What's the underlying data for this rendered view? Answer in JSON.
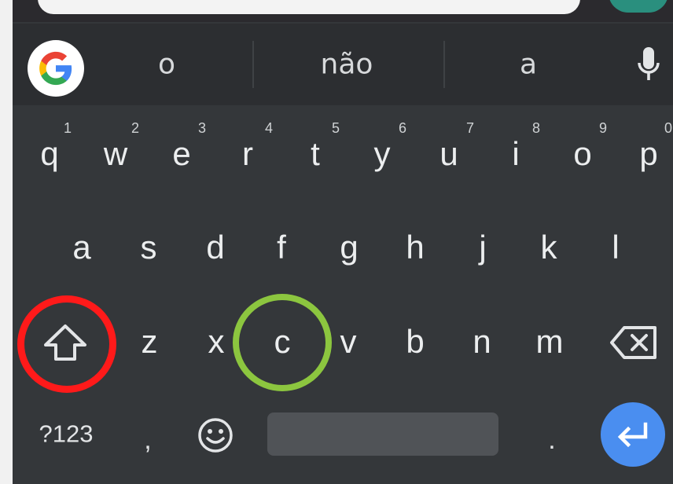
{
  "suggestions": [
    "o",
    "não",
    "a"
  ],
  "row1": [
    {
      "label": "q",
      "hint": "1"
    },
    {
      "label": "w",
      "hint": "2"
    },
    {
      "label": "e",
      "hint": "3"
    },
    {
      "label": "r",
      "hint": "4"
    },
    {
      "label": "t",
      "hint": "5"
    },
    {
      "label": "y",
      "hint": "6"
    },
    {
      "label": "u",
      "hint": "7"
    },
    {
      "label": "i",
      "hint": "8"
    },
    {
      "label": "o",
      "hint": "9"
    },
    {
      "label": "p",
      "hint": "0"
    }
  ],
  "row2": [
    "a",
    "s",
    "d",
    "f",
    "g",
    "h",
    "j",
    "k",
    "l"
  ],
  "row3": [
    "z",
    "x",
    "c",
    "v",
    "b",
    "n",
    "m"
  ],
  "row4": {
    "symbols_label": "?123",
    "comma": ",",
    "period": "."
  },
  "icons": {
    "google": "google-g-icon",
    "mic": "microphone-icon",
    "shift": "shift-arrow-icon",
    "backspace": "backspace-icon",
    "emoji": "smiley-icon",
    "enter": "enter-arrow-icon"
  },
  "colors": {
    "keyboard_bg": "#34373a",
    "suggestion_bar_bg": "#2c2e31",
    "key_text": "#eceeef",
    "space_bar": "#505357",
    "enter_button": "#4a8ef0",
    "highlight_shift": "#ff1a1a",
    "highlight_c": "#8cc63f",
    "google_blue": "#4285f4",
    "google_red": "#ea4335",
    "google_yellow": "#fbbc05",
    "google_green": "#34a853"
  }
}
